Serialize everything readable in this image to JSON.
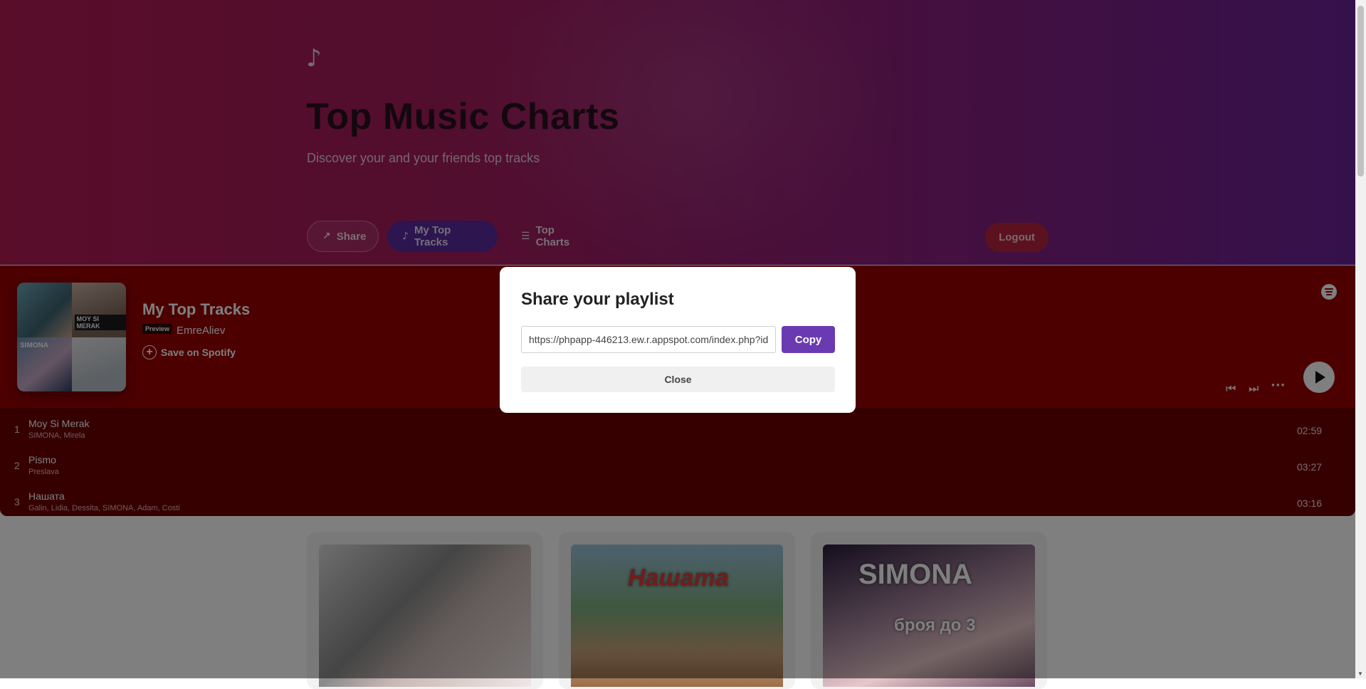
{
  "colors": {
    "hero_gradient_start": "#b21a53",
    "hero_gradient_end": "#6a2398",
    "player_background": "#980000",
    "accent_purple": "#6a3ab2",
    "logout_red": "#b8253c"
  },
  "hero": {
    "note_icon": "music-note-icon",
    "title": "Top Music Charts",
    "subtitle": "Discover your and your friends top tracks"
  },
  "nav": {
    "share_label": "Share",
    "share_icon": "↗",
    "my_top_tracks_label": "My Top Tracks",
    "my_top_tracks_icon": "♪",
    "top_charts_label": "Top Charts",
    "top_charts_icon": "☰",
    "logout_label": "Logout"
  },
  "player": {
    "cover_tags": [
      "MOY SI MERAK",
      "SIMONA"
    ],
    "title": "My Top Tracks",
    "preview_badge": "Preview",
    "owner": "EmreAliev",
    "save_label": "Save on Spotify",
    "tracks": [
      {
        "num": "1",
        "name": "Moy Si Merak",
        "artist": "SIMONA, Mirela",
        "duration": "02:59"
      },
      {
        "num": "2",
        "name": "Pismo",
        "artist": "Preslava",
        "duration": "03:27"
      },
      {
        "num": "3",
        "name": "Нашата",
        "artist": "Galin, Lidia, Dessita, SIMONA, Adam, Costi",
        "duration": "03:16"
      }
    ]
  },
  "cards": [
    {
      "art_label": ""
    },
    {
      "art_label": "Нашата"
    },
    {
      "art_label": "SIMONA",
      "art_sub": "броя до 3"
    }
  ],
  "modal": {
    "title": "Share your playlist",
    "url_value": "https://phpapp-446213.ew.r.appspot.com/index.php?id",
    "copy_label": "Copy",
    "close_label": "Close"
  }
}
